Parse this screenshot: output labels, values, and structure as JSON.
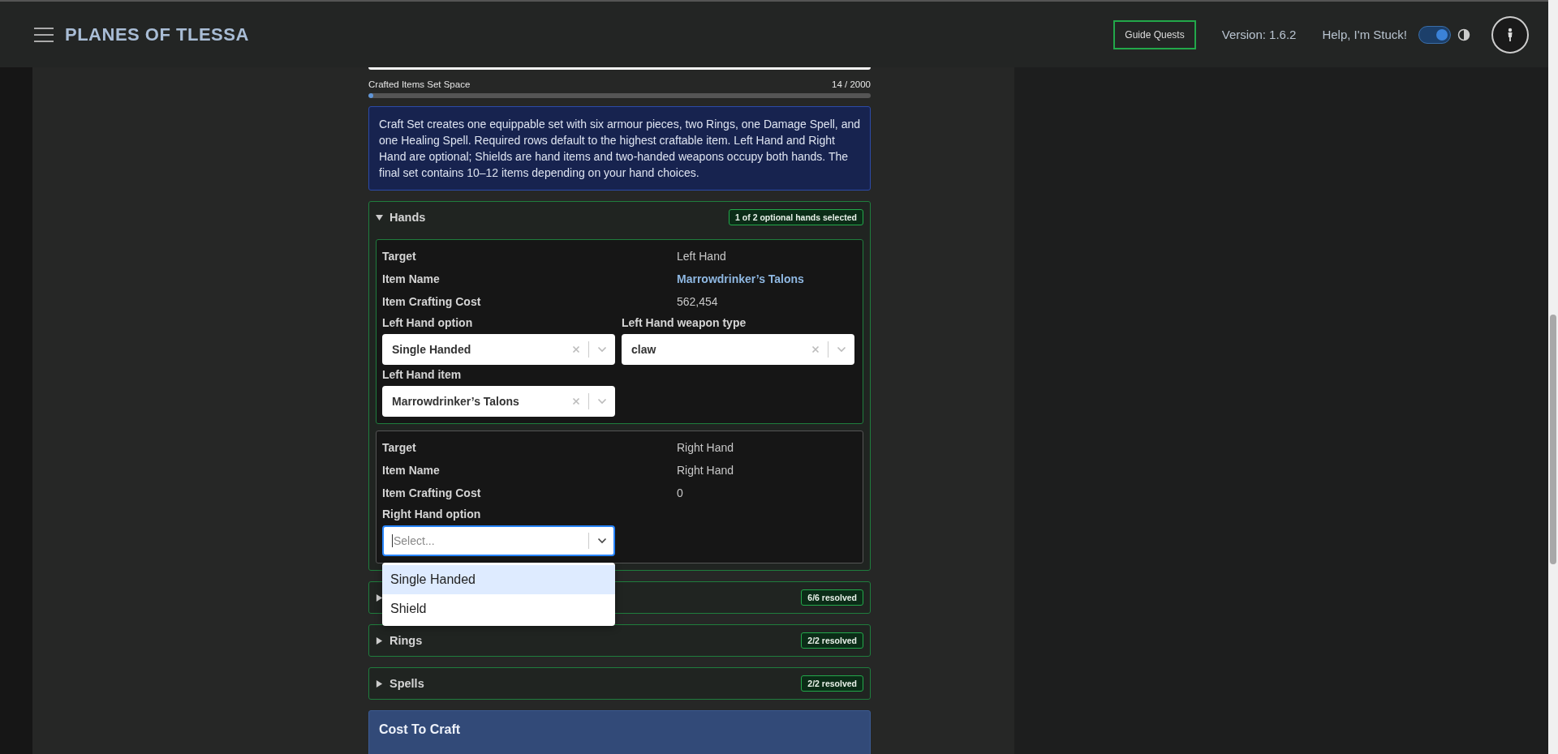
{
  "header": {
    "title": "PLANES OF TLESSA",
    "guide_button": "Guide Quests",
    "version": "Version: 1.6.2",
    "help": "Help, I'm Stuck!",
    "theme_toggle": {
      "on": true
    }
  },
  "capacity": {
    "label": "Crafted Items Set Space",
    "reading": "14 / 2000",
    "level": 0.007
  },
  "notice": "Craft Set creates one equippable set with six armour pieces, two Rings, one Damage Spell, and one Healing Spell. Required rows default to the highest craftable item. Left Hand and Right Hand are optional; Shields are hand items and two-handed weapons occupy both hands. The final set contains 10–12 items depending on your hand choices.",
  "sections": [
    {
      "title": "Hands",
      "expanded": true,
      "badge": "1 of 2 optional hands selected",
      "slots": [
        {
          "selected": true,
          "rows": [
            {
              "label": "Target",
              "value": "Left Hand",
              "kind": "text"
            },
            {
              "label": "Item Name",
              "value": "Marrowdrinker’s Talons",
              "kind": "link"
            },
            {
              "label": "Item Crafting Cost",
              "value": "562,454",
              "kind": "text"
            }
          ],
          "selects": [
            {
              "label": "Left Hand option",
              "value": "Single Handed",
              "focused": false
            },
            {
              "label": "Left Hand weapon type",
              "value": "claw",
              "focused": false
            },
            {
              "label": "Left Hand item",
              "value": "Marrowdrinker’s Talons",
              "focused": false
            }
          ]
        },
        {
          "selected": false,
          "rows": [
            {
              "label": "Target",
              "value": "Right Hand",
              "kind": "text"
            },
            {
              "label": "Item Name",
              "value": "Right Hand",
              "kind": "text"
            },
            {
              "label": "Item Crafting Cost",
              "value": "0",
              "kind": "text"
            }
          ],
          "selects": [
            {
              "label": "Right Hand option",
              "placeholder": "Select...",
              "focused": true,
              "menu": [
                {
                  "label": "Single Handed",
                  "selected": true
                },
                {
                  "label": "Shield",
                  "selected": false
                }
              ]
            }
          ]
        }
      ]
    },
    {
      "expanded": false,
      "badge": "6/6 resolved"
    },
    {
      "title": "Rings",
      "expanded": false,
      "badge": "2/2 resolved"
    },
    {
      "title": "Spells",
      "expanded": false,
      "badge": "2/2 resolved"
    }
  ],
  "cost": {
    "title": "Cost To Craft"
  }
}
